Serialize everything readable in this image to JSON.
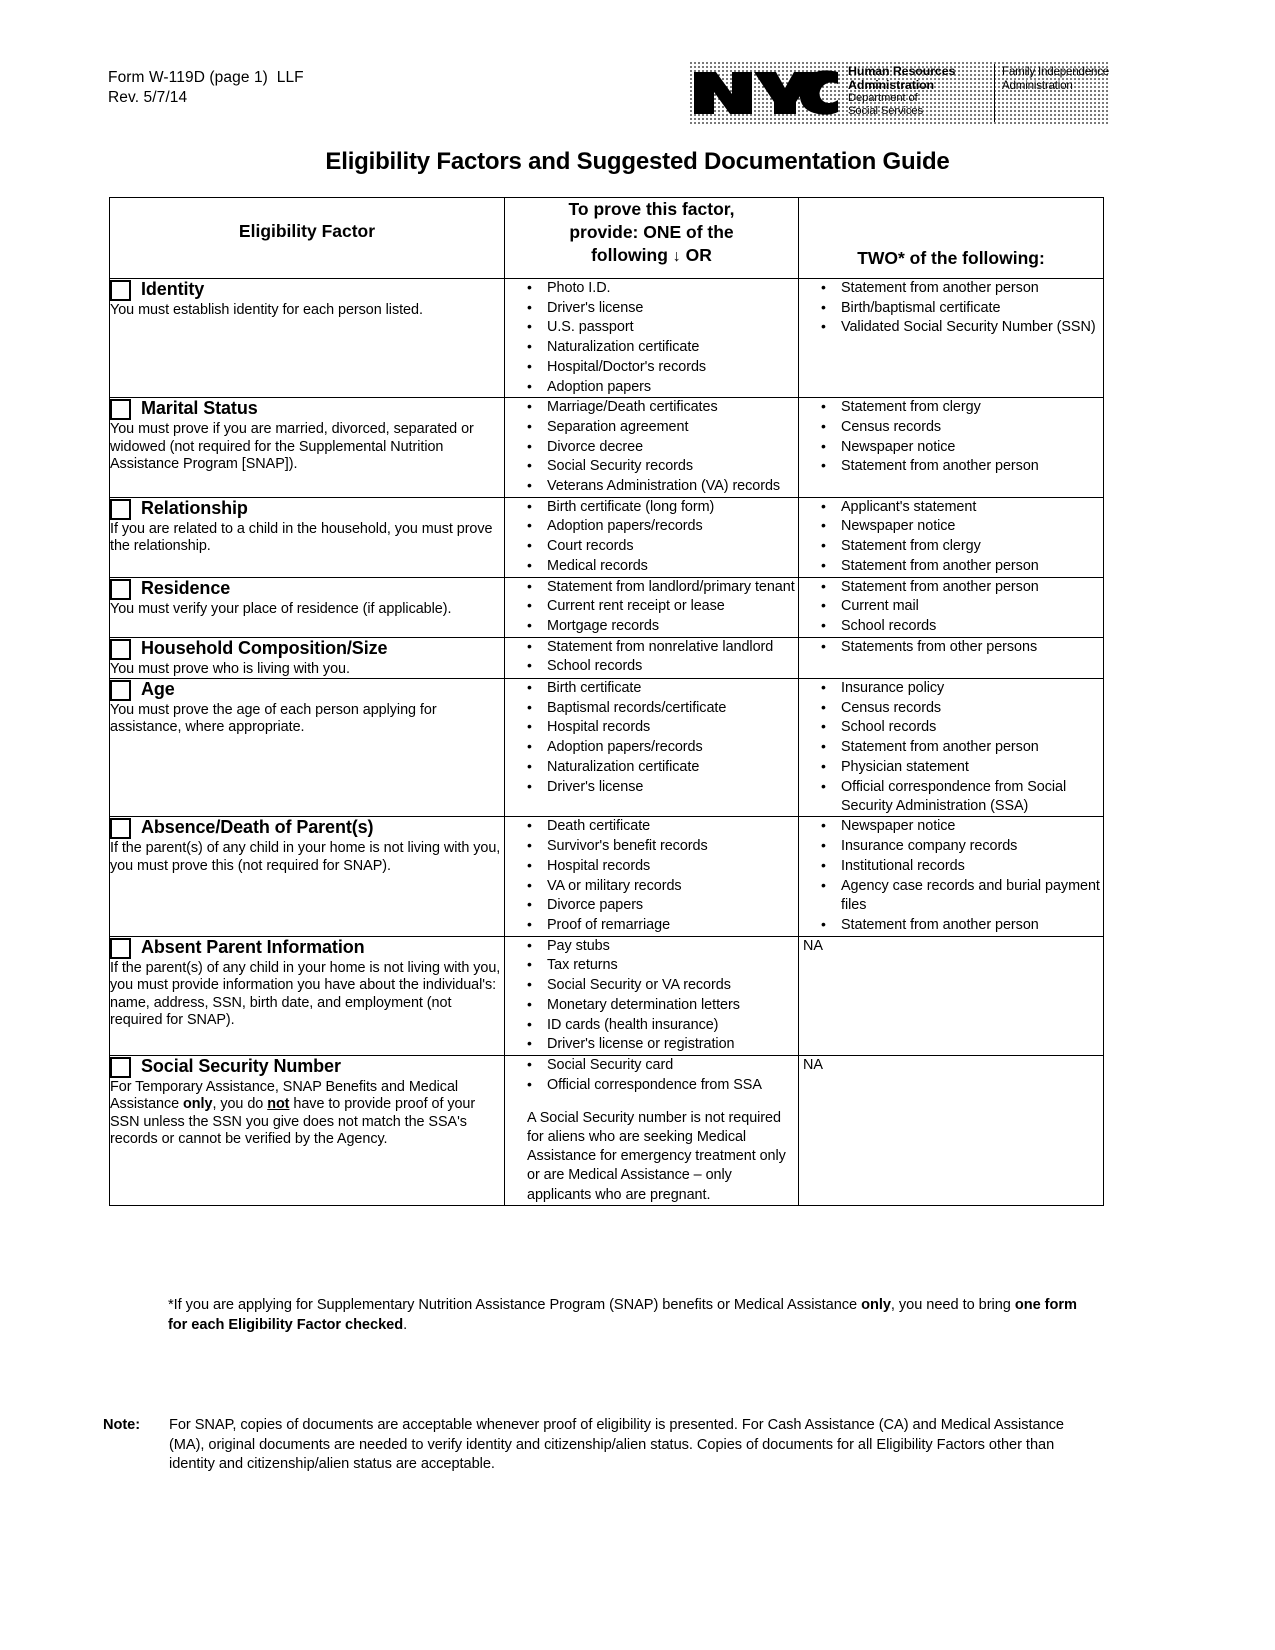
{
  "header": {
    "form_line1": "Form W-119D (page 1)  LLF",
    "form_line2": "Rev. 5/7/14",
    "logo_mark": "NYC",
    "agency_line1": "Human Resources",
    "agency_line2": "Administration",
    "agency_line3": "Department of",
    "agency_line4": "Social Services",
    "sub_agency_line1": "Family Independence",
    "sub_agency_line2": "Administration"
  },
  "title": "Eligibility Factors and Suggested Documentation Guide",
  "table": {
    "headers": {
      "col1": "Eligibility Factor",
      "col2_line1": "To prove this factor,",
      "col2_line2": "provide: ONE of the",
      "col2_line3": "following",
      "col2_arrow": "↓",
      "col2_line3b": "OR",
      "col3": "TWO* of the following:"
    },
    "rows": [
      {
        "factor": "Identity",
        "desc": "You must establish identity for each person listed.",
        "one_of": [
          "Photo I.D.",
          "Driver's license",
          "U.S. passport",
          "Naturalization certificate",
          "Hospital/Doctor's records",
          "Adoption papers"
        ],
        "two_of": [
          "Statement from another person",
          "Birth/baptismal certificate",
          "Validated Social Security Number (SSN)"
        ]
      },
      {
        "factor": "Marital Status",
        "desc": "You must prove if you are married, divorced, separated or widowed (not required for the Supplemental Nutrition Assistance Program [SNAP]).",
        "one_of": [
          "Marriage/Death certificates",
          "Separation agreement",
          "Divorce decree",
          "Social Security records",
          "Veterans Administration (VA) records"
        ],
        "two_of": [
          "Statement from clergy",
          "Census records",
          "Newspaper notice",
          "Statement from another person"
        ]
      },
      {
        "factor": "Relationship",
        "desc": "If you are related to a child in the household, you must prove the relationship.",
        "one_of": [
          "Birth certificate (long form)",
          "Adoption papers/records",
          "Court records",
          "Medical records"
        ],
        "two_of": [
          "Applicant's statement",
          "Newspaper notice",
          "Statement from clergy",
          "Statement from another person"
        ]
      },
      {
        "factor": "Residence",
        "desc": "You must verify your place of residence (if applicable).",
        "one_of": [
          "Statement from landlord/primary tenant",
          "Current rent receipt or lease",
          "Mortgage records"
        ],
        "two_of": [
          "Statement from another person",
          "Current mail",
          "School records"
        ]
      },
      {
        "factor": "Household Composition/Size",
        "desc": "You must prove who is living with you.",
        "one_of": [
          "Statement from nonrelative landlord",
          "School records"
        ],
        "two_of": [
          "Statements from other persons"
        ]
      },
      {
        "factor": "Age",
        "desc": "You must prove the age of each person applying for assistance, where appropriate.",
        "one_of": [
          "Birth certificate",
          "Baptismal records/certificate",
          "Hospital records",
          "Adoption papers/records",
          "Naturalization certificate",
          "Driver's license"
        ],
        "two_of": [
          "Insurance policy",
          "Census records",
          "School records",
          "Statement from another person",
          "Physician statement",
          "Official correspondence from Social Security Administration (SSA)"
        ]
      },
      {
        "factor": "Absence/Death of Parent(s)",
        "desc": "If the parent(s) of any child in your home is not living with you, you must prove this (not required for SNAP).",
        "one_of": [
          "Death certificate",
          "Survivor's benefit records",
          "Hospital records",
          "VA or military records",
          "Divorce papers",
          "Proof of remarriage"
        ],
        "two_of": [
          "Newspaper notice",
          "Insurance company records",
          "Institutional records",
          "Agency case records and burial payment files",
          "Statement from another person"
        ]
      },
      {
        "factor": "Absent Parent Information",
        "desc": "If the parent(s) of any child in your home is not living with you, you must provide information you have about the individual's: name, address, SSN, birth date, and employment (not required for SNAP).",
        "one_of": [
          "Pay stubs",
          "Tax returns",
          "Social Security or VA records",
          "Monetary determination letters",
          "ID cards (health insurance)",
          "Driver's license or registration"
        ],
        "two_of_na": "NA"
      },
      {
        "factor": "Social Security Number",
        "desc_part1": "For Temporary Assistance, SNAP Benefits and Medical Assistance ",
        "desc_bold1": "only",
        "desc_part2": ", you do ",
        "desc_boldu": "not",
        "desc_part3": " have to provide proof of your SSN unless the SSN you give does not match the SSA's records or cannot be verified by the Agency.",
        "one_of": [
          "Social Security card",
          "Official correspondence from SSA"
        ],
        "one_of_note": "A Social Security number is not required for aliens who are seeking Medical Assistance for emergency treatment only or are Medical Assistance – only applicants who are pregnant.",
        "two_of_na": "NA"
      }
    ]
  },
  "footnote": {
    "part1": "*If you are applying for Supplementary Nutrition Assistance Program (SNAP) benefits or Medical Assistance ",
    "bold1": "only",
    "part2": ", you need to bring ",
    "bold2": "one form for each Eligibility Factor checked",
    "part3": "."
  },
  "bottom_note": {
    "label": "Note:",
    "text": "For SNAP, copies of documents are acceptable whenever proof of eligibility is presented. For Cash Assistance (CA) and Medical Assistance (MA), original documents are needed to verify identity and citizenship/alien status. Copies of documents for all Eligibility Factors other than identity and citizenship/alien status are acceptable."
  }
}
